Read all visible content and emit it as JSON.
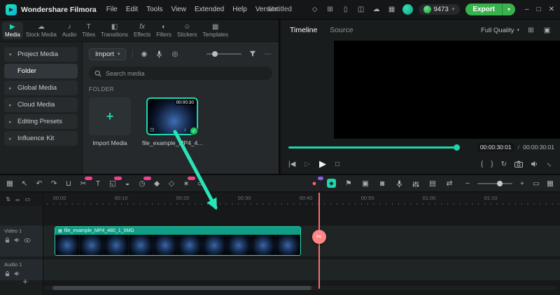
{
  "colors": {
    "accent": "#1fd5ac",
    "export_green": "#38b24d",
    "badge_pink": "#f6408f",
    "badge_purple": "#8b5cf6",
    "playhead_red": "#ff6b6b",
    "check_green": "#17c964"
  },
  "titlebar": {
    "app_name": "Wondershare Filmora",
    "menus": [
      "File",
      "Edit",
      "Tools",
      "View",
      "Extended",
      "Help",
      "Version"
    ],
    "document_title": "Untitled",
    "icons": [
      {
        "name": "store-icon",
        "glyph": "◇"
      },
      {
        "name": "plugins-icon",
        "glyph": "⊞"
      },
      {
        "name": "mobile-icon",
        "glyph": "▯"
      },
      {
        "name": "screencast-icon",
        "glyph": "◫"
      },
      {
        "name": "cloud-icon",
        "glyph": "☁"
      },
      {
        "name": "layouts-icon",
        "glyph": "▦"
      }
    ],
    "credits": "9473",
    "credits_add": "+",
    "export_label": "Export",
    "export_caret": "▾",
    "window_controls": {
      "minimize": "–",
      "maximize": "□",
      "close": "✕"
    }
  },
  "media_panel": {
    "tabs": [
      {
        "label": "Media",
        "glyph": "▶"
      },
      {
        "label": "Stock Media",
        "glyph": "☁"
      },
      {
        "label": "Audio",
        "glyph": "♪"
      },
      {
        "label": "Titles",
        "glyph": "T"
      },
      {
        "label": "Transitions",
        "glyph": "◧"
      },
      {
        "label": "Effects",
        "glyph": "fx"
      },
      {
        "label": "Filters",
        "glyph": "◐"
      },
      {
        "label": "Stickers",
        "glyph": "☺"
      },
      {
        "label": "Templates",
        "glyph": "▦"
      }
    ],
    "sidebar": [
      {
        "label": "Project Media",
        "chevron": "▾"
      },
      {
        "label": "Folder"
      },
      {
        "label": "Global Media",
        "chevron": "▸"
      },
      {
        "label": "Cloud Media",
        "chevron": "▸"
      },
      {
        "label": "Editing Presets",
        "chevron": "▸"
      },
      {
        "label": "Influence Kit",
        "chevron": "▸"
      }
    ],
    "toolbar": {
      "import_label": "Import",
      "import_caret": "▾",
      "record_glyph": "◉",
      "webcam_glyph": "◎",
      "ellipsis": "⋯"
    },
    "search_placeholder": "Search media",
    "section_label": "FOLDER",
    "import_tile_label": "Import Media",
    "plus_glyph": "+",
    "clip_tile": {
      "name": "file_example_MP4_4...",
      "duration": "00:00:30",
      "check": "✓",
      "download_glyph": "↓",
      "type_glyph": "◫"
    }
  },
  "preview": {
    "tabs": [
      {
        "label": "Timeline"
      },
      {
        "label": "Source"
      }
    ],
    "quality": "Full Quality",
    "quality_caret": "▾",
    "header_icons": [
      {
        "name": "layout-grid-icon",
        "glyph": "⊞"
      },
      {
        "name": "preview-frame-icon",
        "glyph": "▣"
      }
    ],
    "current_time": "00:00:30:01",
    "separator": "/",
    "total_time": "00:00:30:01",
    "transport": {
      "step_back": "|◀",
      "step_fwd": "▷",
      "play": "▶",
      "stop": "□",
      "mark_in": "{",
      "mark_out": "}",
      "rotate": "↻",
      "fullscreen": "↔"
    }
  },
  "timeline": {
    "toolbar_left": [
      {
        "name": "toolbar-menu-icon",
        "glyph": "▦"
      },
      {
        "name": "select-tool-icon",
        "glyph": "↖"
      },
      {
        "name": "undo-icon",
        "glyph": "↶"
      },
      {
        "name": "redo-icon",
        "glyph": "↷"
      },
      {
        "name": "delete-icon",
        "glyph": "⊔"
      },
      {
        "name": "split-icon",
        "glyph": "✂",
        "badge": true
      },
      {
        "name": "text-tool-icon",
        "glyph": "T"
      },
      {
        "name": "crop-icon",
        "glyph": "◱",
        "badge": true
      },
      {
        "name": "mask-icon",
        "glyph": "◒"
      },
      {
        "name": "speed-icon",
        "glyph": "◷",
        "badge": true
      },
      {
        "name": "keyframe-icon",
        "glyph": "◆"
      },
      {
        "name": "transform-icon",
        "glyph": "◇"
      },
      {
        "name": "ai-tools-icon",
        "glyph": "∗",
        "badge": true
      },
      {
        "name": "render-icon",
        "glyph": "▭"
      }
    ],
    "record_glyph": "●",
    "keyframe_glyph": "◆",
    "center_icons": [
      {
        "name": "marker-icon",
        "glyph": "⚑"
      },
      {
        "name": "snapshot-icon",
        "glyph": "▣"
      },
      {
        "name": "chroma-key-icon",
        "glyph": "◙"
      },
      {
        "name": "film-roll-icon",
        "glyph": "▤"
      },
      {
        "name": "auto-ripple-icon",
        "glyph": "⇄"
      }
    ],
    "zoom": {
      "out": "−",
      "in": "+"
    },
    "right_icons": [
      {
        "name": "fit-timeline-icon",
        "glyph": "▭"
      },
      {
        "name": "track-manager-icon",
        "glyph": "▦"
      }
    ],
    "ruler_labels": [
      "00:00",
      "00:10",
      "00:20",
      "00:30",
      "00:40",
      "00:50",
      "01:00",
      "01:10"
    ],
    "header_icons": [
      {
        "name": "collapse-tracks-icon",
        "glyph": "⇅"
      },
      {
        "name": "link-clips-icon",
        "glyph": "∞"
      },
      {
        "name": "ruler-options-icon",
        "glyph": "▭"
      }
    ],
    "tracks": [
      {
        "label": "Video 1"
      },
      {
        "label": "Audio 1"
      }
    ],
    "clip": {
      "label": "file_example_MP4_480_1_5MG",
      "icon_glyph": "▦"
    },
    "playhead_scissors": "✂",
    "add_track": "+"
  }
}
